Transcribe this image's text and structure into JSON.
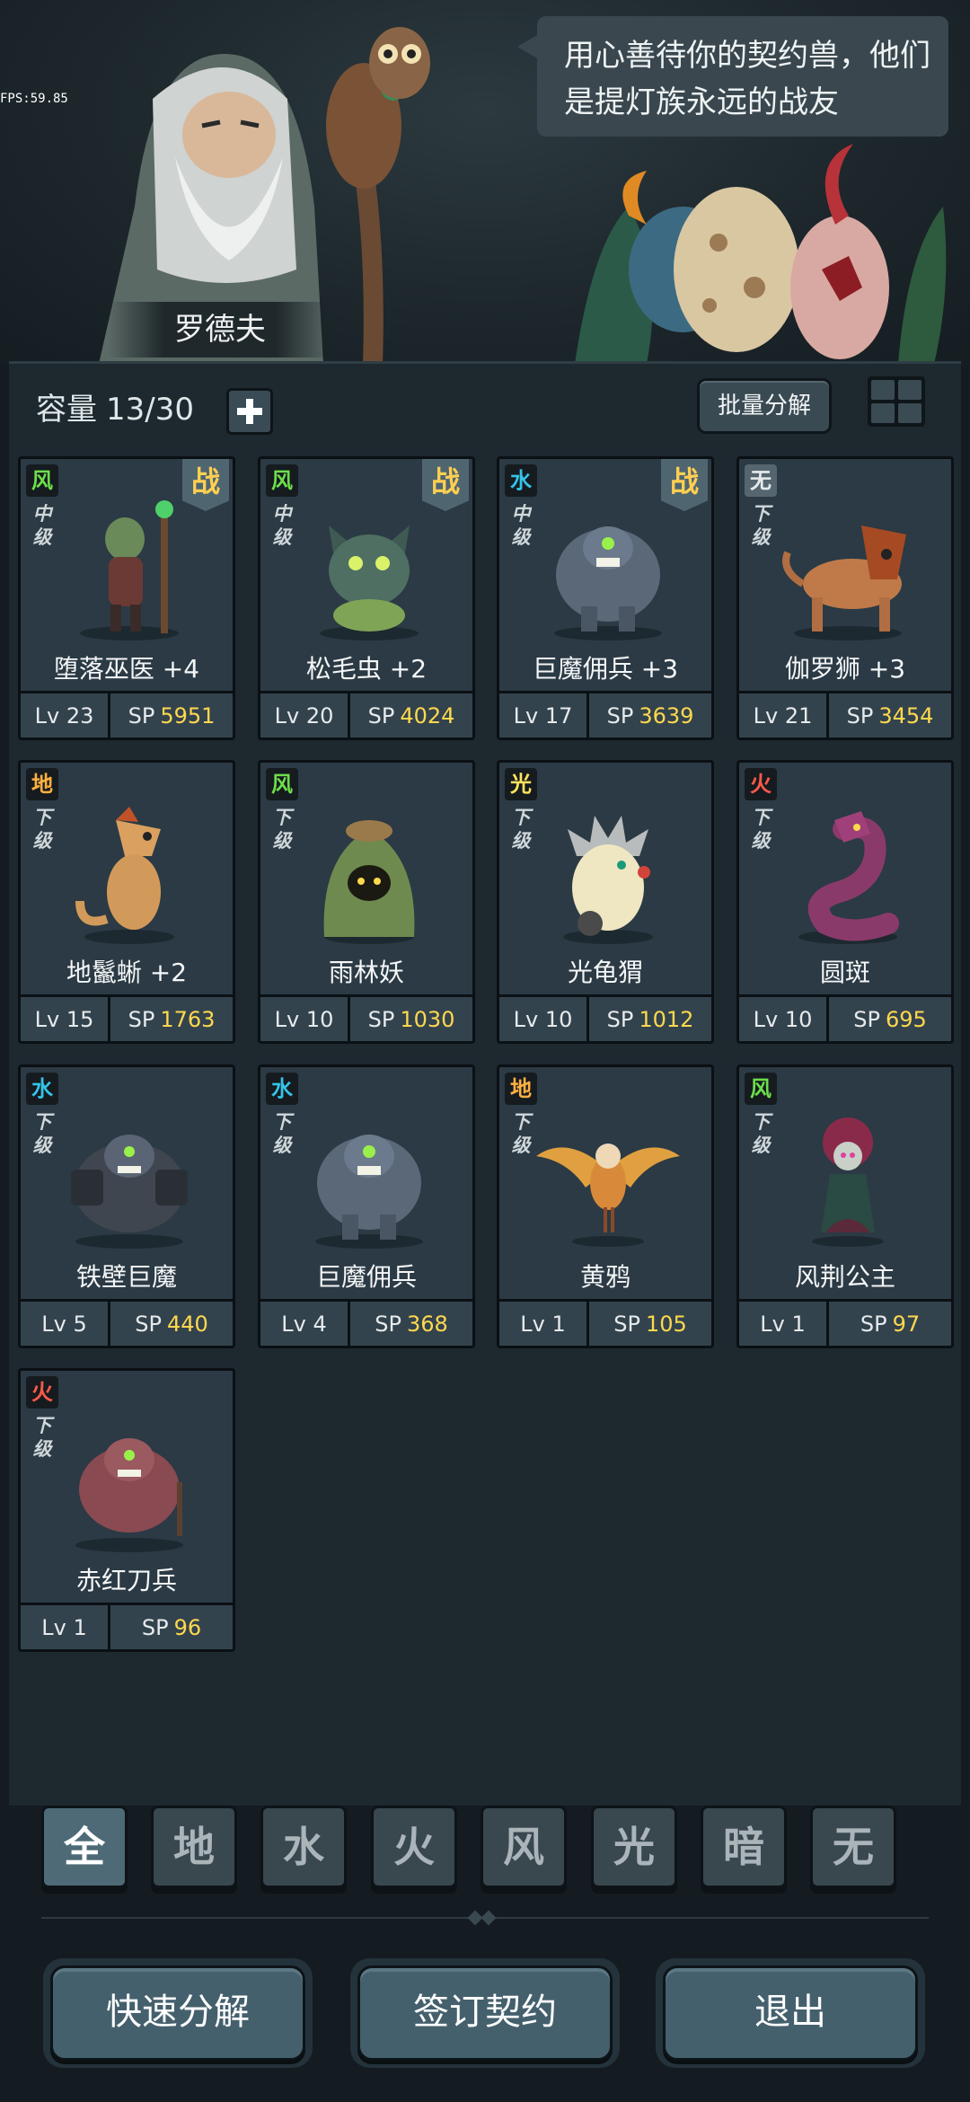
{
  "fps": "FPS:59.85",
  "dialog": {
    "line1": "用心善待你的契约兽，他们",
    "line2": "是提灯族永远的战友"
  },
  "npc_name": "罗德夫",
  "capacity": {
    "label": "容量",
    "value": "13/30"
  },
  "batch_button": "批量分解",
  "colors": {
    "wind": "#6dde4b",
    "water": "#34c3e8",
    "earth": "#ffb040",
    "fire": "#ff5a4a",
    "light": "#ffe35a",
    "sp_value": "#ffd84e"
  },
  "cards": [
    {
      "element": "风",
      "grade": "中级",
      "battle": "战",
      "name": "堕落巫医 +4",
      "lv": "Lv 23",
      "sp_label": "SP",
      "sp": "5951"
    },
    {
      "element": "风",
      "grade": "中级",
      "battle": "战",
      "name": "松毛虫 +2",
      "lv": "Lv 20",
      "sp_label": "SP",
      "sp": "4024"
    },
    {
      "element": "水",
      "grade": "中级",
      "battle": "战",
      "name": "巨魔佣兵 +3",
      "lv": "Lv 17",
      "sp_label": "SP",
      "sp": "3639"
    },
    {
      "element": "无",
      "grade": "下级",
      "name": "伽罗狮 +3",
      "lv": "Lv 21",
      "sp_label": "SP",
      "sp": "3454"
    },
    {
      "element": "地",
      "grade": "下级",
      "name": "地鬣蜥 +2",
      "lv": "Lv 15",
      "sp_label": "SP",
      "sp": "1763"
    },
    {
      "element": "风",
      "grade": "下级",
      "name": "雨林妖",
      "lv": "Lv 10",
      "sp_label": "SP",
      "sp": "1030"
    },
    {
      "element": "光",
      "grade": "下级",
      "name": "光龟猬",
      "lv": "Lv 10",
      "sp_label": "SP",
      "sp": "1012"
    },
    {
      "element": "火",
      "grade": "下级",
      "name": "圆斑",
      "lv": "Lv 10",
      "sp_label": "SP",
      "sp": "695"
    },
    {
      "element": "水",
      "grade": "下级",
      "name": "铁壁巨魔",
      "lv": "Lv 5",
      "sp_label": "SP",
      "sp": "440"
    },
    {
      "element": "水",
      "grade": "下级",
      "name": "巨魔佣兵",
      "lv": "Lv 4",
      "sp_label": "SP",
      "sp": "368"
    },
    {
      "element": "地",
      "grade": "下级",
      "name": "黄鸦",
      "lv": "Lv 1",
      "sp_label": "SP",
      "sp": "105"
    },
    {
      "element": "风",
      "grade": "下级",
      "name": "风荆公主",
      "lv": "Lv 1",
      "sp_label": "SP",
      "sp": "97"
    },
    {
      "element": "火",
      "grade": "下级",
      "name": "赤红刀兵",
      "lv": "Lv 1",
      "sp_label": "SP",
      "sp": "96"
    }
  ],
  "filter_tabs": [
    "全",
    "地",
    "水",
    "火",
    "风",
    "光",
    "暗",
    "无"
  ],
  "active_tab": "全",
  "buttons": {
    "quick_decompose": "快速分解",
    "sign_contract": "签订契约",
    "exit": "退出"
  }
}
